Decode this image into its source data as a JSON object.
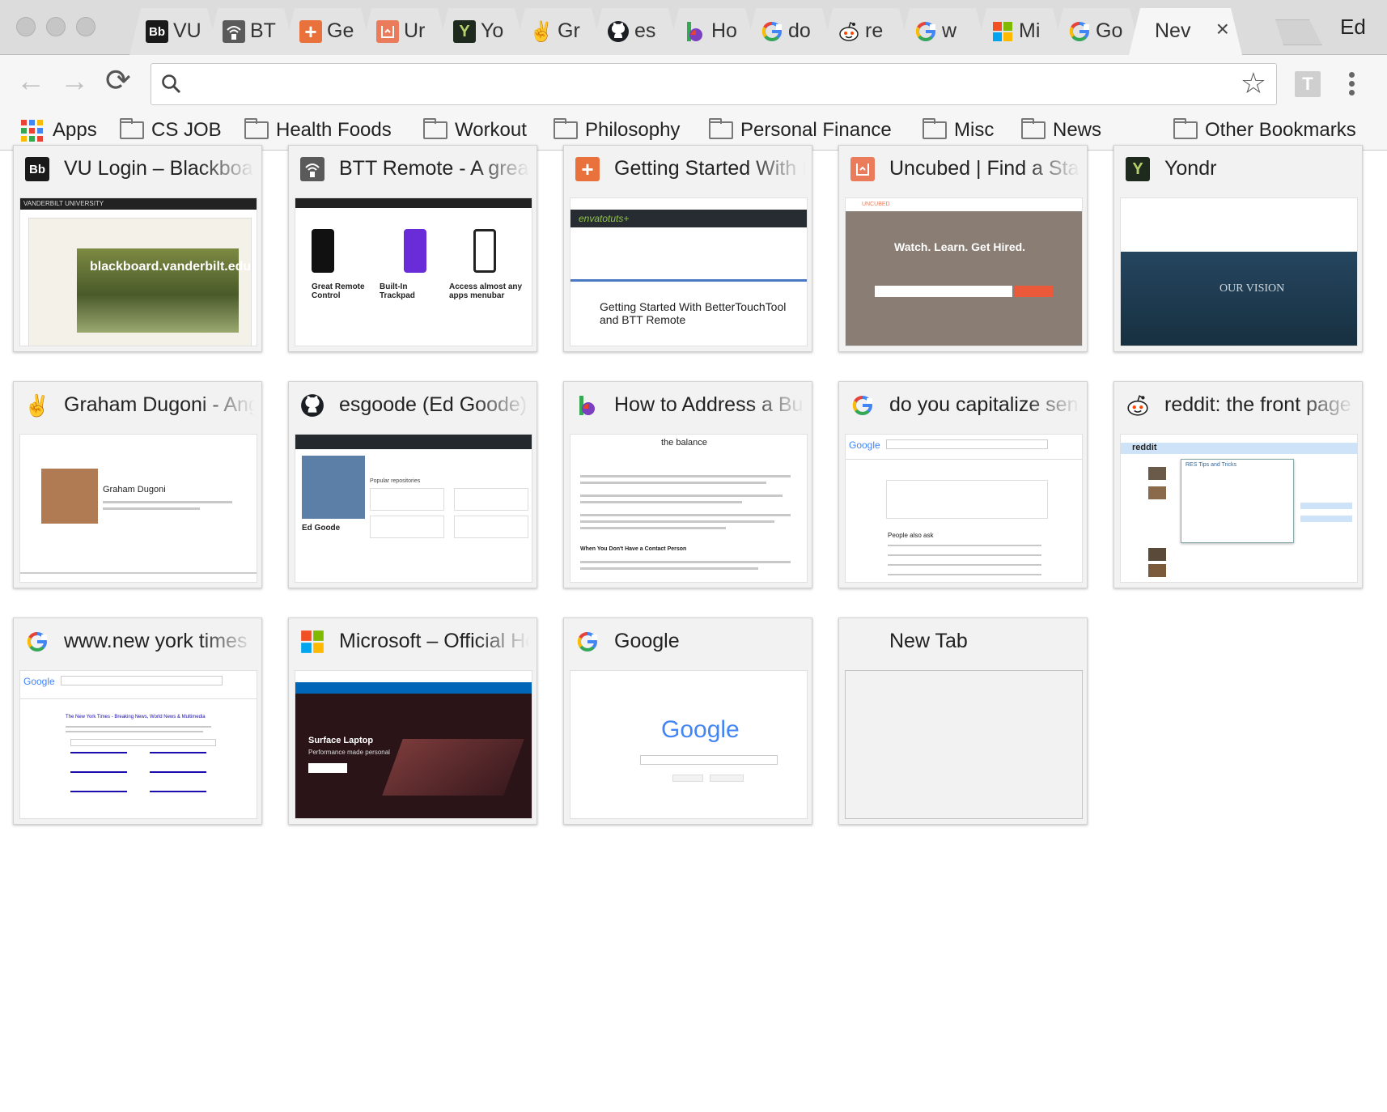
{
  "window": {
    "profile_name": "Ed",
    "traffic_lights": [
      "close",
      "minimize",
      "zoom"
    ]
  },
  "tabs": [
    {
      "title": "VU",
      "icon": "blackboard-icon",
      "icon_text": "Bb",
      "icon_bg": "#1a1a1a"
    },
    {
      "title": "BT",
      "icon": "btt-remote-icon",
      "icon_text": "",
      "icon_bg": "#555555"
    },
    {
      "title": "Ge",
      "icon": "envato-tuts-icon",
      "icon_text": "+",
      "icon_bg": "#e8713c"
    },
    {
      "title": "Ur",
      "icon": "uncubed-icon",
      "icon_text": "",
      "icon_bg": "#ea7b5b"
    },
    {
      "title": "Yo",
      "icon": "yondr-icon",
      "icon_text": "Y",
      "icon_bg": "#1f2a1f"
    },
    {
      "title": "Gr",
      "icon": "angellist-icon",
      "icon_text": "✌",
      "icon_bg": "#ffffff"
    },
    {
      "title": "es",
      "icon": "github-icon",
      "icon_text": "",
      "icon_bg": "#ffffff"
    },
    {
      "title": "Ho",
      "icon": "the-balance-icon",
      "icon_text": "b",
      "icon_bg": "#ffffff"
    },
    {
      "title": "do",
      "icon": "google-icon",
      "icon_text": "G",
      "icon_bg": "#ffffff"
    },
    {
      "title": "re",
      "icon": "reddit-icon",
      "icon_text": "",
      "icon_bg": "#ffffff"
    },
    {
      "title": "w",
      "icon": "google-icon",
      "icon_text": "G",
      "icon_bg": "#ffffff"
    },
    {
      "title": "Mi",
      "icon": "microsoft-icon",
      "icon_text": "",
      "icon_bg": "#ffffff"
    },
    {
      "title": "Go",
      "icon": "google-icon",
      "icon_text": "G",
      "icon_bg": "#ffffff"
    },
    {
      "title": "Nev",
      "icon": "",
      "icon_text": "",
      "icon_bg": "",
      "active": true
    }
  ],
  "toolbar": {
    "back": "←",
    "forward": "→",
    "reload": "⟳",
    "omnibox_value": "",
    "star": "☆",
    "avatar_letter": "T"
  },
  "bookmarks": [
    {
      "label": "Apps",
      "type": "apps"
    },
    {
      "label": "CS JOB",
      "type": "folder"
    },
    {
      "label": "Health Foods",
      "type": "folder"
    },
    {
      "label": "Workout",
      "type": "folder"
    },
    {
      "label": "Philosophy",
      "type": "folder"
    },
    {
      "label": "Personal Finance",
      "type": "folder"
    },
    {
      "label": "Misc",
      "type": "folder"
    },
    {
      "label": "News",
      "type": "folder"
    },
    {
      "label": "Other Bookmarks",
      "type": "folder"
    }
  ],
  "tiles": [
    {
      "title": "VU Login – Blackboard",
      "icon": "blackboard-icon",
      "thumb_text": "blackboard.vanderbilt.edu",
      "thumb_header": "VANDERBILT UNIVERSITY"
    },
    {
      "title": "BTT Remote - A great",
      "icon": "btt-remote-icon",
      "thumb_text": "Great Remote Control",
      "thumb_text2": "Built-In Trackpad",
      "thumb_text3": "Access almost any apps menubar"
    },
    {
      "title": "Getting Started With BetterTouchTool",
      "icon": "envato-tuts-icon",
      "thumb_text": "Getting Started With BetterTouchTool and BTT Remote",
      "thumb_header": "envatotuts+"
    },
    {
      "title": "Uncubed | Find a Startup Job",
      "icon": "uncubed-icon",
      "thumb_text": "Watch. Learn. Get Hired.",
      "thumb_header": "UNCUBED"
    },
    {
      "title": "Yondr",
      "icon": "yondr-icon",
      "thumb_text": "OUR VISION"
    },
    {
      "title": "Graham Dugoni - AngelList",
      "icon": "angellist-icon",
      "thumb_text": "Graham Dugoni"
    },
    {
      "title": "esgoode (Ed Goode)",
      "icon": "github-icon",
      "thumb_text": "Ed Goode",
      "thumb_text2": "Popular repositories"
    },
    {
      "title": "How to Address a Business Letter",
      "icon": "the-balance-icon",
      "thumb_text": "the balance",
      "thumb_text2": "When You Don't Have a Contact Person"
    },
    {
      "title": "do you capitalize senior",
      "icon": "google-icon",
      "thumb_text": "Google",
      "thumb_text2": "People also ask"
    },
    {
      "title": "reddit: the front page of the internet",
      "icon": "reddit-icon",
      "thumb_text": "reddit",
      "thumb_text2": "RES Tips and Tricks"
    },
    {
      "title": "www.new york times - Google Search",
      "icon": "google-icon",
      "thumb_text": "Google",
      "thumb_text2": "The New York Times - Breaking News, World News & Multimedia"
    },
    {
      "title": "Microsoft – Official Home Page",
      "icon": "microsoft-icon",
      "thumb_text": "Surface Laptop",
      "thumb_text2": "Performance made personal"
    },
    {
      "title": "Google",
      "icon": "google-icon",
      "thumb_text": "Google"
    },
    {
      "title": "New Tab",
      "icon": "",
      "empty": true
    }
  ],
  "colors": {
    "google_blue": "#4285f4",
    "google_red": "#ea4335",
    "google_yellow": "#fbbc05",
    "google_green": "#34a853",
    "reddit_orange": "#ff4500"
  }
}
